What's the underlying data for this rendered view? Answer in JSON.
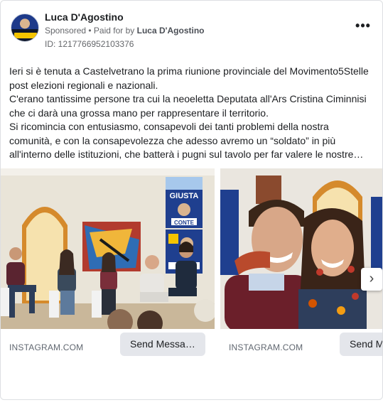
{
  "post": {
    "author": "Luca D'Agostino",
    "sponsored": "Sponsored",
    "paid_for_prefix": "• Paid for by",
    "paid_for_name": "Luca D'Agostino",
    "ad_id": "ID: 1217766952103376",
    "more_icon": "more-dots-icon",
    "body_lines": [
      "Ieri si è tenuta a Castelvetrano la prima riunione provinciale del Movimento5Stelle post elezioni regionali e nazionali.",
      "C'erano tantissime persone tra cui la neoeletta Deputata all'Ars Cristina Ciminnisi che ci darà una grossa mano per rappresentare il territorio.",
      "Si ricomincia con entusiasmo, consapevoli dei tanti problemi della nostra comunità, e con la consapevolezza che adesso avremo un “soldato” in più all'interno delle istituzioni, che batterà i pugni sul tavolo per far valere le nostre…"
    ]
  },
  "carousel": {
    "cards": [
      {
        "domain": "INSTAGRAM.COM",
        "cta": "Send Messa…"
      },
      {
        "domain": "INSTAGRAM.COM",
        "cta": "Send M"
      }
    ],
    "poster_text_1": "GIUSTA",
    "poster_text_2": "CONTE",
    "next_icon": "chevron-right-icon"
  }
}
